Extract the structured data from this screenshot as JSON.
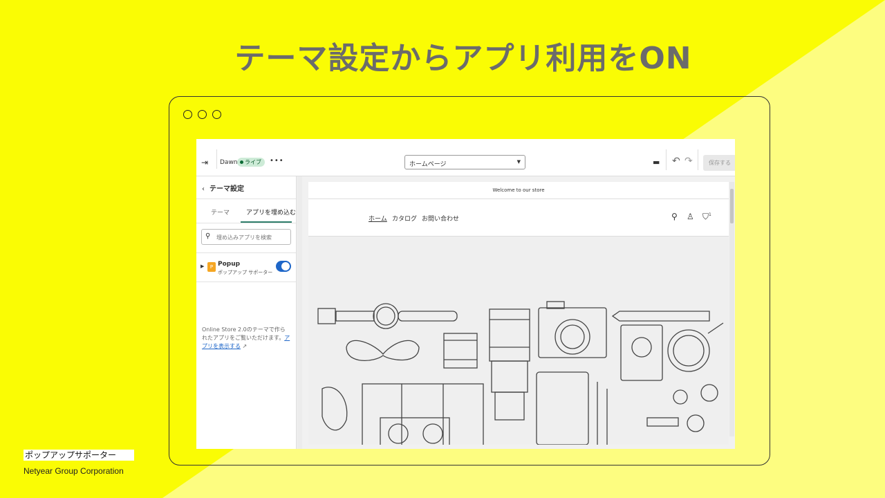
{
  "slide": {
    "title": "テーマ設定からアプリ利用をON",
    "brand_name": "ポップアップサポーター",
    "company": "Netyear Group Corporation",
    "colors": {
      "background": "#fafc04",
      "accent_light": "#fdfd7a",
      "title": "#6b6b6b"
    }
  },
  "editor": {
    "topbar": {
      "exit_icon": "exit-icon",
      "theme_name": "Dawn",
      "live_badge": "ライブ",
      "more_label": "•••",
      "page_select": "ホームページ",
      "save_label": "保存する"
    },
    "sidebar": {
      "back_label": "‹",
      "title": "テーマ設定",
      "tabs": [
        {
          "label": "テーマ"
        },
        {
          "label": "アプリを埋め込む"
        }
      ],
      "search_placeholder": "埋め込みアプリを検索",
      "app": {
        "name": "Popup",
        "subtitle": "ポップアップ サポーター",
        "enabled": true,
        "icon_text": "P"
      },
      "note": "Online Store 2.0のテーマで作られたアプリをご覧いただけます。",
      "note_link": "アプリを表示する"
    },
    "preview": {
      "announcement": "Welcome to our store",
      "nav": [
        {
          "label": "ホーム"
        },
        {
          "label": "カタログ"
        },
        {
          "label": "お問い合わせ"
        }
      ],
      "cart_count": "1"
    }
  }
}
